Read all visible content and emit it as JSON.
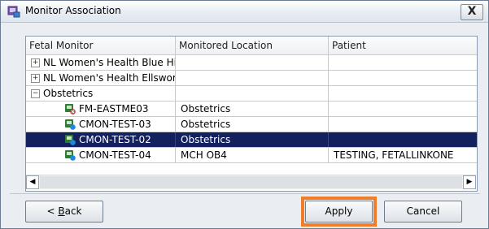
{
  "window": {
    "title": "Monitor Association",
    "close_label": "X"
  },
  "grid": {
    "columns": [
      "Fetal Monitor",
      "Monitored Location",
      "Patient"
    ],
    "rows": [
      {
        "type": "group",
        "expander": "+",
        "monitor": "NL Women's Health Blue Hil",
        "location": "",
        "patient": ""
      },
      {
        "type": "group",
        "expander": "+",
        "monitor": "NL Women's Health Ellswort",
        "location": "",
        "patient": ""
      },
      {
        "type": "group",
        "expander": "−",
        "monitor": "Obstetrics",
        "location": "",
        "patient": ""
      },
      {
        "type": "device",
        "icon": "fetal-monitor-error-icon",
        "monitor": "FM-EASTME03",
        "location": "Obstetrics",
        "patient": ""
      },
      {
        "type": "device",
        "icon": "fetal-monitor-ok-icon",
        "monitor": "CMON-TEST-03",
        "location": "Obstetrics",
        "patient": ""
      },
      {
        "type": "device",
        "icon": "fetal-monitor-ok-icon",
        "monitor": "CMON-TEST-02",
        "location": "Obstetrics",
        "patient": "",
        "selected": true
      },
      {
        "type": "device",
        "icon": "fetal-monitor-ok-icon",
        "monitor": "CMON-TEST-04",
        "location": "MCH OB4",
        "patient": "TESTING, FETALLINKONE"
      }
    ]
  },
  "scrollbar": {
    "left_arrow": "◀",
    "right_arrow": "▶"
  },
  "buttons": {
    "back_prefix": "< ",
    "back_accel": "B",
    "back_rest": "ack",
    "apply": "Apply",
    "cancel": "Cancel"
  },
  "colors": {
    "selection": "#13215f",
    "highlight": "#f07d2a"
  }
}
